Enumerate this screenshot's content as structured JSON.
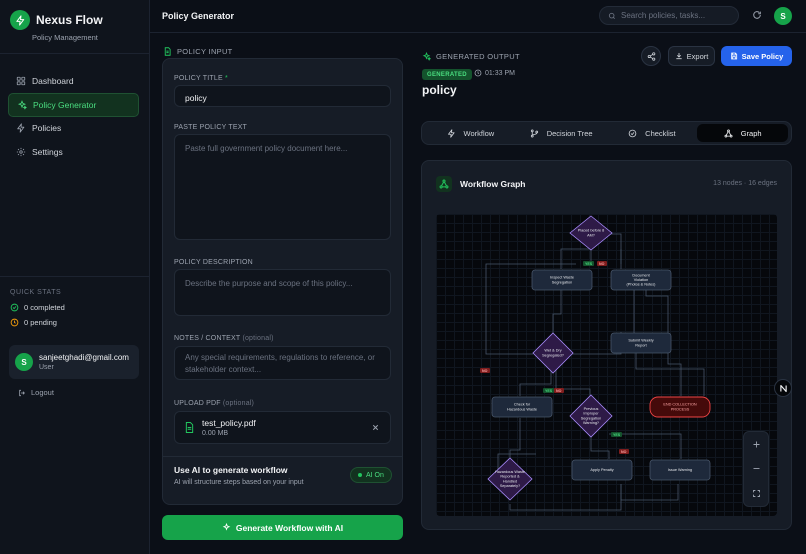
{
  "app": {
    "name": "Nexus Flow",
    "subtitle": "Policy Management"
  },
  "sidebar": {
    "items": [
      {
        "label": "Dashboard",
        "icon": "grid-icon"
      },
      {
        "label": "Policy Generator",
        "icon": "sparkle-icon",
        "active": true
      },
      {
        "label": "Policies",
        "icon": "zap-icon"
      },
      {
        "label": "Settings",
        "icon": "gear-icon"
      }
    ],
    "quick_stats": {
      "title": "QUICK STATS",
      "completed": "0 completed",
      "pending": "0 pending"
    },
    "user": {
      "initial": "S",
      "email": "sanjeetghadi@gmail.com",
      "role": "User"
    },
    "logout": "Logout"
  },
  "topbar": {
    "title": "Policy Generator",
    "search_placeholder": "Search policies, tasks...",
    "avatar_initial": "S"
  },
  "input_panel": {
    "section_label": "POLICY INPUT",
    "title_label": "POLICY TITLE",
    "title_required": "*",
    "title_value": "policy",
    "paste_label": "PASTE POLICY TEXT",
    "paste_placeholder": "Paste full government policy document here...",
    "desc_label": "POLICY DESCRIPTION",
    "desc_placeholder": "Describe the purpose and scope of this policy...",
    "notes_label": "NOTES / CONTEXT",
    "notes_optional": "(optional)",
    "notes_placeholder": "Any special requirements, regulations to reference, or stakeholder context...",
    "upload_label": "UPLOAD PDF",
    "upload_optional": "(optional)",
    "file_name": "test_policy.pdf",
    "file_size": "0.00 MB",
    "ai_title": "Use AI to generate workflow",
    "ai_sub": "AI will structure steps based on your input",
    "ai_toggle": "AI On",
    "generate_button": "Generate Workflow with AI"
  },
  "output_panel": {
    "section_label": "GENERATED OUTPUT",
    "badge": "GENERATED",
    "time": "01:33 PM",
    "title": "policy",
    "export": "Export",
    "save": "Save Policy",
    "tabs": [
      {
        "label": "Workflow",
        "icon": "zap-icon"
      },
      {
        "label": "Decision Tree",
        "icon": "branch-icon"
      },
      {
        "label": "Checklist",
        "icon": "check-circle-icon"
      },
      {
        "label": "Graph",
        "icon": "network-icon",
        "active": true
      }
    ],
    "graph": {
      "title": "Workflow Graph",
      "stats": "13 nodes · 16 edges",
      "nodes": {
        "placed_before": "Placed before 8 AM?",
        "inspect": "Inspect Waste Segregation",
        "document_violation": "Document Violation (Photos & Notes)",
        "wet_dry": "Wet & Dry Segregated?",
        "submit_report": "Submit Weekly Report",
        "check_hazardous": "Check for Hazardous Waste",
        "previous_improper": "Previous Improper Segregation Warning?",
        "end_collection": "END COLLECTION PROCESS",
        "apply_penalty": "Apply Penalty",
        "issue_warning": "Issue Warning",
        "hazardous_reported": "Hazardous Waste Reported & Handled Separately?"
      },
      "edge_labels": {
        "yes": "YES",
        "no": "NO"
      }
    }
  },
  "colors": {
    "accent": "#16a34a",
    "primary_button": "#2563eb",
    "node_fill": "#1e293b",
    "decision_fill": "#2e1a47",
    "end_node": "#7f1d1d"
  }
}
